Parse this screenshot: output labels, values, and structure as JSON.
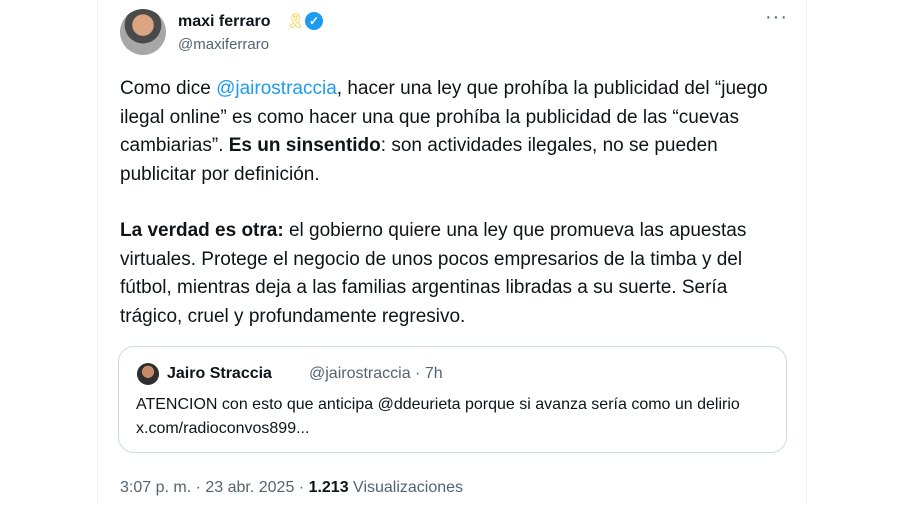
{
  "author": {
    "name": "maxi ferraro",
    "ribbon_icon": "yellow-ribbon-icon",
    "verified_icon": "verified-badge-icon",
    "handle": "@maxiferraro"
  },
  "menu": {
    "more_label": "···"
  },
  "body": {
    "p1": {
      "t1": "Como dice ",
      "mention": "@jairostraccia",
      "t2": ", hacer una ley que prohíba la publicidad del “juego ilegal online” es como hacer una que prohíba la publicidad de las “cuevas cambiarias”. ",
      "bold": "Es un sinsentido",
      "t3": ": son actividades ilegales, no se pueden publicitar por definición."
    },
    "p2": {
      "bold": "La verdad es otra:",
      "t1": " el gobierno quiere una ley que promueva las apuestas virtuales. Protege el negocio de unos pocos empresarios de la timba y del fútbol, mientras deja a las familias argentinas libradas a su suerte. Sería trágico, cruel y profundamente regresivo."
    }
  },
  "quote": {
    "name": "Jairo Straccia",
    "handle_time": "@jairostraccia · 7h",
    "text": "ATENCION con esto que anticipa @ddeurieta porque si avanza sería como un delirio x.com/radioconvos899..."
  },
  "footer": {
    "time": "3:07 p. m.",
    "sep1": " · ",
    "date": "23 abr. 2025",
    "sep2": " · ",
    "views_count": "1.213",
    "views_label": " Visualizaciones"
  }
}
